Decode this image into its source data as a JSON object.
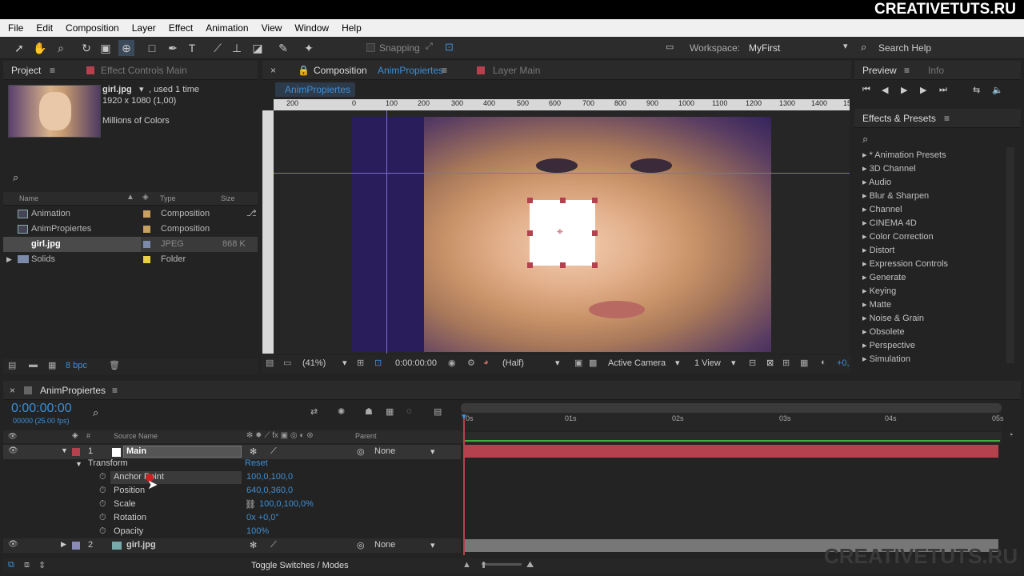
{
  "watermark": "CREATIVETUTS.RU",
  "watermark_bottom": "CREATIVETUTS.RU",
  "menu": [
    "File",
    "Edit",
    "Composition",
    "Layer",
    "Effect",
    "Animation",
    "View",
    "Window",
    "Help"
  ],
  "toolbar": {
    "snapping": "Snapping",
    "workspace_label": "Workspace:",
    "workspace_value": "MyFirst",
    "search_placeholder": "Search Help"
  },
  "project": {
    "tab": "Project",
    "tab2": "Effect Controls Main",
    "file_name": "girl.jpg",
    "used": ", used 1 time",
    "dims": "1920 x 1080 (1,00)",
    "colors": "Millions of Colors",
    "col_name": "Name",
    "col_type": "Type",
    "col_size": "Size",
    "items": [
      {
        "name": "Animation",
        "type": "Composition",
        "size": ""
      },
      {
        "name": "AnimPropiertes",
        "type": "Composition",
        "size": ""
      },
      {
        "name": "girl.jpg",
        "type": "JPEG",
        "size": "868 K"
      },
      {
        "name": "Solids",
        "type": "Folder",
        "size": ""
      }
    ],
    "bpc": "8 bpc"
  },
  "comp": {
    "tab_prefix": "Composition",
    "tab_name": "AnimPropiertes",
    "tab2": "Layer Main",
    "breadcrumb": "AnimPropiertes",
    "ruler": [
      "200",
      "0",
      "100",
      "200",
      "300",
      "400",
      "500",
      "600",
      "700",
      "800",
      "900",
      "1000",
      "1100",
      "1200",
      "1300",
      "1400",
      "15"
    ],
    "zoom": "(41%)",
    "time": "0:00:00:00",
    "resolution": "(Half)",
    "camera": "Active Camera",
    "views": "1 View",
    "offset": "+0,"
  },
  "preview": {
    "tab": "Preview",
    "tab2": "Info"
  },
  "effects": {
    "tab": "Effects & Presets",
    "items": [
      "* Animation Presets",
      "3D Channel",
      "Audio",
      "Blur & Sharpen",
      "Channel",
      "CINEMA 4D",
      "Color Correction",
      "Distort",
      "Expression Controls",
      "Generate",
      "Keying",
      "Matte",
      "Noise & Grain",
      "Obsolete",
      "Perspective",
      "Simulation"
    ]
  },
  "timeline": {
    "tab": "AnimPropiertes",
    "timecode": "0:00:00:00",
    "frames": "00000 (25.00 fps)",
    "col_source": "Source Name",
    "col_parent": "Parent",
    "ticks": [
      "0s",
      "01s",
      "02s",
      "03s",
      "04s",
      "05s"
    ],
    "layer1": {
      "num": "1",
      "name": "Main",
      "parent": "None"
    },
    "transform": {
      "label": "Transform",
      "reset": "Reset",
      "props": [
        {
          "name": "Anchor Point",
          "value": "100,0,100,0"
        },
        {
          "name": "Position",
          "value": "640,0,360,0"
        },
        {
          "name": "Scale",
          "value": "100,0,100,0%"
        },
        {
          "name": "Rotation",
          "value": "0x +0,0°"
        },
        {
          "name": "Opacity",
          "value": "100%"
        }
      ]
    },
    "layer2": {
      "num": "2",
      "name": "girl.jpg",
      "parent": "None"
    },
    "toggle": "Toggle Switches / Modes"
  },
  "colors": {
    "accent": "#3c8fd6",
    "layer_red": "#b5414f",
    "comp_purple": "#2a1d5c"
  }
}
